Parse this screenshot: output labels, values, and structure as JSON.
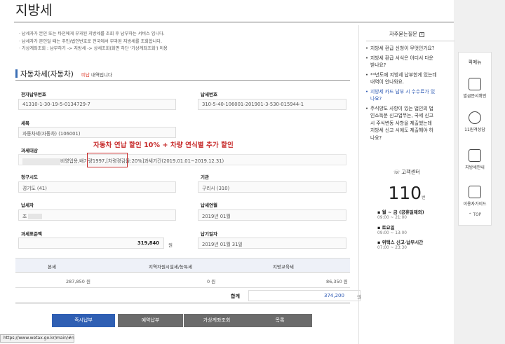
{
  "page": {
    "title": "지방세"
  },
  "notes": [
    "· 납세자가 본인 또는 타인에게 부과된 지방세를 조회 후 납부하는 서비스 입니다.",
    "· 납세자가 본인일 때는 주민/법인번호로 전국에서 부과된 지방세를 조회합니다.",
    "· 가상계좌조회 : 납부하기 -> 지방세 -> 상세조회(화면 하단 '가상계좌조회') 이용"
  ],
  "section": {
    "title": "자동차세(자동차)",
    "status": "미납",
    "suffix": " 내역입니다"
  },
  "form": {
    "epay_label": "전자납부번호",
    "epay_value": "41310-1-30-19-5-0134729-7",
    "taxno_label": "납세번호",
    "taxno_value": "310-5-40-106001-201901-3-530-015944-1",
    "item_label": "세목",
    "item_value": "자동차세(자동차) (106001)",
    "target_label": "과세대상",
    "target_value": "비영업용,배기량1997,[차령경감율:20%]과세기간(2019.01.01~2019.12.31)",
    "region_label": "청구시도",
    "region_value": "경기도 (41)",
    "agency_label": "기관",
    "agency_value": "구리시 (310)",
    "payer_label": "납세자",
    "payer_value": "조",
    "ym_label": "납세연월",
    "ym_value": "2019년 01월",
    "base_label": "과세표준액",
    "base_value": "319,840",
    "base_unit": "원",
    "due_label": "납기일자",
    "due_value": "2019년 01월 31일"
  },
  "annotation": "자동차 연납 할인 10% + 차량 연식별 추가 할인",
  "summary": {
    "headers": [
      "본세",
      "지역자원시설세/농특세",
      "지방교육세"
    ],
    "values": [
      "287,850 원",
      "0 원",
      "86,350 원"
    ],
    "total_label": "합계",
    "total_value": "374,200",
    "total_unit": "원"
  },
  "buttons": {
    "pay_now": "즉시납부",
    "reserve": "예약납부",
    "vaccount": "가상계좌조회",
    "list": "목록"
  },
  "status_url": "https://www.wetax.go.kr/main/#n",
  "faq": {
    "title": "자주묻는질문",
    "items": [
      [
        "지방세 환급 신청이 무엇인가요?"
      ],
      [
        "지방세 환급 서식은 어디서 다운",
        "받나요?"
      ],
      [
        "**년도에 지방세 납부한게 있는데",
        "내역이 안나와요."
      ],
      [
        "지방세 카드 납부 시 수수료가 있",
        "나요?"
      ],
      [
        "주식양도 사항이 있는 법인의 법",
        "인소득분 신고업무는, 국세 신고",
        "시 주식변동 사항을 제출했는데",
        "지방세 신고 시에도 제출해야 하",
        "나요?"
      ]
    ]
  },
  "callcenter": {
    "title": "고객센터",
    "number": "110",
    "number_unit": "번",
    "hours": [
      {
        "h": "월 ~ 금 (공휴일제외)",
        "t": [
          "09:00 ~ 21:00"
        ]
      },
      {
        "h": "토요일",
        "t": [
          "09:00 ~ 13:00"
        ]
      },
      {
        "h": "위택스 신고·납부시간",
        "t": [
          "07:00 ~ 23:30"
        ]
      }
    ]
  },
  "quickmenu": {
    "title": "퀵메뉴",
    "items": [
      "발급문서확인",
      "11원격상담",
      "지방세안내",
      "이용자가이드"
    ],
    "top": "TOP"
  }
}
